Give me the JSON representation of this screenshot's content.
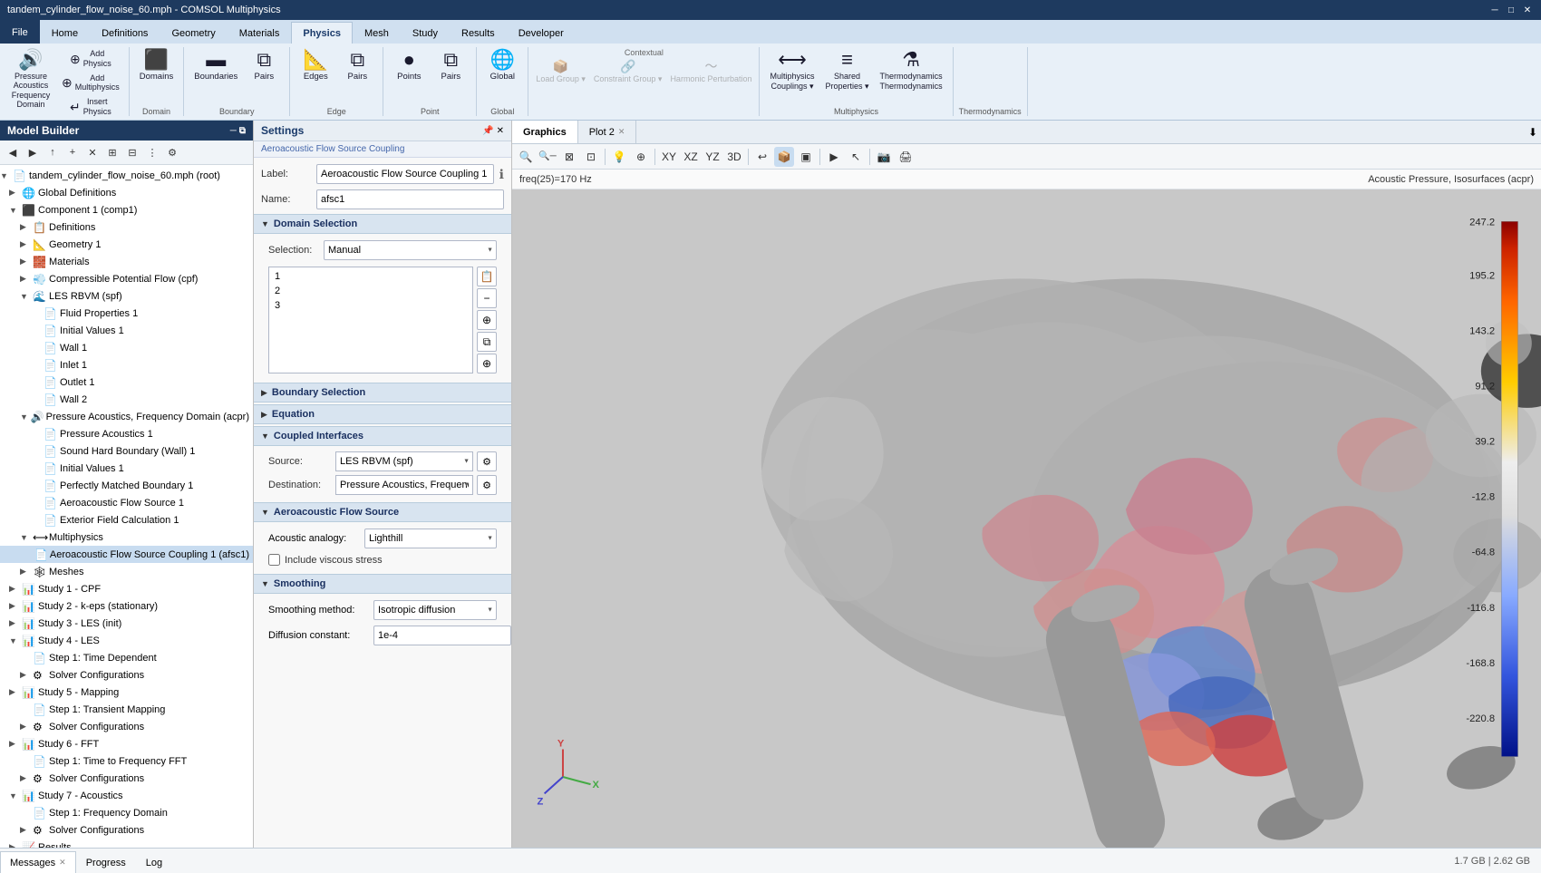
{
  "titleBar": {
    "title": "tandem_cylinder_flow_noise_60.mph - COMSOL Multiphysics",
    "minimize": "─",
    "restore": "□",
    "close": "✕"
  },
  "ribbonTabs": [
    {
      "id": "file",
      "label": "File",
      "active": false
    },
    {
      "id": "home",
      "label": "Home",
      "active": false
    },
    {
      "id": "definitions",
      "label": "Definitions",
      "active": false
    },
    {
      "id": "geometry",
      "label": "Geometry",
      "active": false
    },
    {
      "id": "materials",
      "label": "Materials",
      "active": false
    },
    {
      "id": "physics",
      "label": "Physics",
      "active": true
    },
    {
      "id": "mesh",
      "label": "Mesh",
      "active": false
    },
    {
      "id": "study",
      "label": "Study",
      "active": false
    },
    {
      "id": "results",
      "label": "Results",
      "active": false
    },
    {
      "id": "developer",
      "label": "Developer",
      "active": false
    }
  ],
  "ribbonGroups": {
    "physics": {
      "domain": {
        "label": "Domain",
        "buttons": [
          {
            "id": "pressure-acoustics-freq",
            "icon": "🔊",
            "label": "Pressure Acoustics\nFrequency Domain",
            "active": false
          },
          {
            "id": "add-physics",
            "icon": "⊕",
            "label": "Add\nPhysics",
            "active": false
          },
          {
            "id": "add-multiphysics",
            "icon": "⊕",
            "label": "Add\nMultiphysics",
            "active": false
          },
          {
            "id": "insert-physics",
            "icon": "↩",
            "label": "Insert\nPhysics",
            "active": false
          }
        ]
      },
      "domainBtn": {
        "id": "domains",
        "icon": "⬛",
        "label": "Domains",
        "active": false
      },
      "boundary": {
        "label": "Boundary",
        "buttons": [
          {
            "id": "boundaries",
            "icon": "▭",
            "label": "Boundaries",
            "active": false
          },
          {
            "id": "pairs",
            "icon": "⧉",
            "label": "Pairs",
            "active": false
          }
        ]
      },
      "edge": {
        "label": "Edge",
        "buttons": [
          {
            "id": "edges",
            "icon": "📐",
            "label": "Edges",
            "active": false
          },
          {
            "id": "edge-pairs",
            "icon": "⧉",
            "label": "Pairs",
            "active": false
          }
        ]
      },
      "point": {
        "label": "Point",
        "buttons": [
          {
            "id": "points",
            "icon": "•",
            "label": "Points",
            "active": false
          },
          {
            "id": "point-pairs",
            "icon": "⧉",
            "label": "Pairs",
            "active": false
          }
        ]
      },
      "global": {
        "label": "Global",
        "buttons": [
          {
            "id": "global",
            "icon": "🌐",
            "label": "Global",
            "active": false
          }
        ]
      },
      "contextual": {
        "label": "Contextual",
        "buttons": [
          {
            "id": "load-group",
            "icon": "📦",
            "label": "Load Group ▾",
            "disabled": true
          },
          {
            "id": "constraint-group",
            "icon": "🔗",
            "label": "Constraint Group ▾",
            "disabled": true
          },
          {
            "id": "harmonic-perturbation",
            "icon": "〜",
            "label": "Harmonic Perturbation",
            "disabled": true
          }
        ]
      },
      "multiphysics": {
        "label": "Multiphysics",
        "buttons": [
          {
            "id": "multiphysics-couplings",
            "icon": "⟷",
            "label": "Multiphysics\nCouplings"
          },
          {
            "id": "shared-properties",
            "icon": "≡",
            "label": "Shared\nProperties"
          },
          {
            "id": "thermodynamics",
            "icon": "⚗",
            "label": "Thermodynamics"
          }
        ]
      }
    }
  },
  "modelBuilder": {
    "title": "Model Builder",
    "tree": [
      {
        "level": 0,
        "expand": "down",
        "icon": "📄",
        "label": "tandem_cylinder_flow_noise_60.mph (root)",
        "type": "root"
      },
      {
        "level": 1,
        "expand": "right",
        "icon": "🌐",
        "label": "Global Definitions",
        "type": "global"
      },
      {
        "level": 1,
        "expand": "down",
        "icon": "⬛",
        "label": "Component 1 (comp1)",
        "type": "component"
      },
      {
        "level": 2,
        "expand": "right",
        "icon": "📋",
        "label": "Definitions",
        "type": "folder"
      },
      {
        "level": 2,
        "expand": "right",
        "icon": "📐",
        "label": "Geometry 1",
        "type": "folder"
      },
      {
        "level": 2,
        "expand": "right",
        "icon": "🧱",
        "label": "Materials",
        "type": "folder"
      },
      {
        "level": 2,
        "expand": "right",
        "icon": "💨",
        "label": "Compressible Potential Flow (cpf)",
        "type": "physics"
      },
      {
        "level": 2,
        "expand": "down",
        "icon": "🌊",
        "label": "LES RBVM (spf)",
        "type": "physics"
      },
      {
        "level": 3,
        "expand": "none",
        "icon": "📄",
        "label": "Fluid Properties 1",
        "type": "node"
      },
      {
        "level": 3,
        "expand": "none",
        "icon": "📄",
        "label": "Initial Values 1",
        "type": "node"
      },
      {
        "level": 3,
        "expand": "none",
        "icon": "📄",
        "label": "Wall 1",
        "type": "node"
      },
      {
        "level": 3,
        "expand": "none",
        "icon": "📄",
        "label": "Inlet 1",
        "type": "node"
      },
      {
        "level": 3,
        "expand": "none",
        "icon": "📄",
        "label": "Outlet 1",
        "type": "node"
      },
      {
        "level": 3,
        "expand": "none",
        "icon": "📄",
        "label": "Wall 2",
        "type": "node"
      },
      {
        "level": 2,
        "expand": "down",
        "icon": "🔊",
        "label": "Pressure Acoustics, Frequency Domain (acpr)",
        "type": "physics"
      },
      {
        "level": 3,
        "expand": "none",
        "icon": "📄",
        "label": "Pressure Acoustics 1",
        "type": "node"
      },
      {
        "level": 3,
        "expand": "none",
        "icon": "📄",
        "label": "Sound Hard Boundary (Wall) 1",
        "type": "node"
      },
      {
        "level": 3,
        "expand": "none",
        "icon": "📄",
        "label": "Initial Values 1",
        "type": "node"
      },
      {
        "level": 3,
        "expand": "none",
        "icon": "📄",
        "label": "Perfectly Matched Boundary 1",
        "type": "node"
      },
      {
        "level": 3,
        "expand": "none",
        "icon": "📄",
        "label": "Aeroacoustic Flow Source 1",
        "type": "node"
      },
      {
        "level": 3,
        "expand": "none",
        "icon": "📄",
        "label": "Exterior Field Calculation 1",
        "type": "node"
      },
      {
        "level": 2,
        "expand": "down",
        "icon": "⟷",
        "label": "Multiphysics",
        "type": "multiphysics"
      },
      {
        "level": 3,
        "expand": "none",
        "icon": "📄",
        "label": "Aeroacoustic Flow Source Coupling 1 (afsc1)",
        "type": "node",
        "selected": true
      },
      {
        "level": 2,
        "expand": "right",
        "icon": "🕸",
        "label": "Meshes",
        "type": "folder"
      },
      {
        "level": 1,
        "expand": "right",
        "icon": "📊",
        "label": "Study 1 - CPF",
        "type": "study"
      },
      {
        "level": 1,
        "expand": "right",
        "icon": "📊",
        "label": "Study 2 - k-eps (stationary)",
        "type": "study"
      },
      {
        "level": 1,
        "expand": "right",
        "icon": "📊",
        "label": "Study 3 - LES (init)",
        "type": "study"
      },
      {
        "level": 1,
        "expand": "down",
        "icon": "📊",
        "label": "Study 4 - LES",
        "type": "study"
      },
      {
        "level": 2,
        "expand": "none",
        "icon": "📄",
        "label": "Step 1: Time Dependent",
        "type": "node"
      },
      {
        "level": 2,
        "expand": "right",
        "icon": "⚙",
        "label": "Solver Configurations",
        "type": "folder"
      },
      {
        "level": 1,
        "expand": "right",
        "icon": "📊",
        "label": "Study 5 - Mapping",
        "type": "study"
      },
      {
        "level": 2,
        "expand": "none",
        "icon": "📄",
        "label": "Step 1: Transient Mapping",
        "type": "node"
      },
      {
        "level": 2,
        "expand": "right",
        "icon": "⚙",
        "label": "Solver Configurations",
        "type": "folder"
      },
      {
        "level": 1,
        "expand": "right",
        "icon": "📊",
        "label": "Study 6 - FFT",
        "type": "study"
      },
      {
        "level": 2,
        "expand": "none",
        "icon": "📄",
        "label": "Step 1: Time to Frequency FFT",
        "type": "node"
      },
      {
        "level": 2,
        "expand": "right",
        "icon": "⚙",
        "label": "Solver Configurations",
        "type": "folder"
      },
      {
        "level": 1,
        "expand": "down",
        "icon": "📊",
        "label": "Study 7 - Acoustics",
        "type": "study"
      },
      {
        "level": 2,
        "expand": "none",
        "icon": "📄",
        "label": "Step 1: Frequency Domain",
        "type": "node"
      },
      {
        "level": 2,
        "expand": "right",
        "icon": "⚙",
        "label": "Solver Configurations",
        "type": "folder"
      },
      {
        "level": 1,
        "expand": "right",
        "icon": "📈",
        "label": "Results",
        "type": "results"
      }
    ]
  },
  "settings": {
    "title": "Settings",
    "subtitle": "Aeroacoustic Flow Source Coupling",
    "labelField": {
      "label": "Label:",
      "value": "Aeroacoustic Flow Source Coupling 1"
    },
    "nameField": {
      "label": "Name:",
      "value": "afsc1"
    },
    "sections": {
      "domainSelection": {
        "label": "Domain Selection",
        "selectionLabel": "Selection:",
        "selectionValue": "Manual",
        "domains": [
          "1",
          "2",
          "3"
        ]
      },
      "boundarySelection": {
        "label": "Boundary Selection"
      },
      "equation": {
        "label": "Equation"
      },
      "coupledInterfaces": {
        "label": "Coupled Interfaces",
        "source": {
          "label": "Source:",
          "value": "LES RBVM (spf)"
        },
        "destination": {
          "label": "Destination:",
          "value": "Pressure Acoustics, Frequency Domain (acpr)"
        }
      },
      "aeroacousticFlowSource": {
        "label": "Aeroacoustic Flow Source",
        "acousticAnalogy": {
          "label": "Acoustic analogy:",
          "value": "Lighthill"
        },
        "includeViscousStress": {
          "label": "Include viscous stress",
          "checked": false
        }
      },
      "smoothing": {
        "label": "Smoothing",
        "smoothingMethod": {
          "label": "Smoothing method:",
          "value": "Isotropic diffusion"
        },
        "diffusionConstant": {
          "label": "Diffusion constant:",
          "value": "1e-4"
        }
      }
    }
  },
  "graphics": {
    "tabs": [
      {
        "id": "graphics",
        "label": "Graphics",
        "active": true,
        "closeable": false
      },
      {
        "id": "plot2",
        "label": "Plot 2",
        "active": false,
        "closeable": true
      }
    ],
    "toolbar": {
      "buttons": [
        "🔍+",
        "🔍-",
        "⟲",
        "📷",
        "⊠",
        "▷",
        "⟳",
        "🎨",
        "📐",
        "💾",
        "🖨"
      ]
    },
    "freqInfo": "freq(25)=170 Hz",
    "titleInfo": "Acoustic Pressure, Isosurfaces (acpr)",
    "colorScale": {
      "values": [
        "247.2",
        "195.2",
        "143.2",
        "91.2",
        "39.2",
        "-12.8",
        "-64.8",
        "-116.8",
        "-168.8",
        "-220.8"
      ]
    }
  },
  "messagesPanel": {
    "tabs": [
      {
        "id": "messages",
        "label": "Messages",
        "active": true,
        "closeable": true
      },
      {
        "id": "progress",
        "label": "Progress",
        "active": false,
        "closeable": false
      },
      {
        "id": "log",
        "label": "Log",
        "active": false,
        "closeable": false
      }
    ],
    "statusBar": "1.7 GB | 2.62 GB"
  }
}
